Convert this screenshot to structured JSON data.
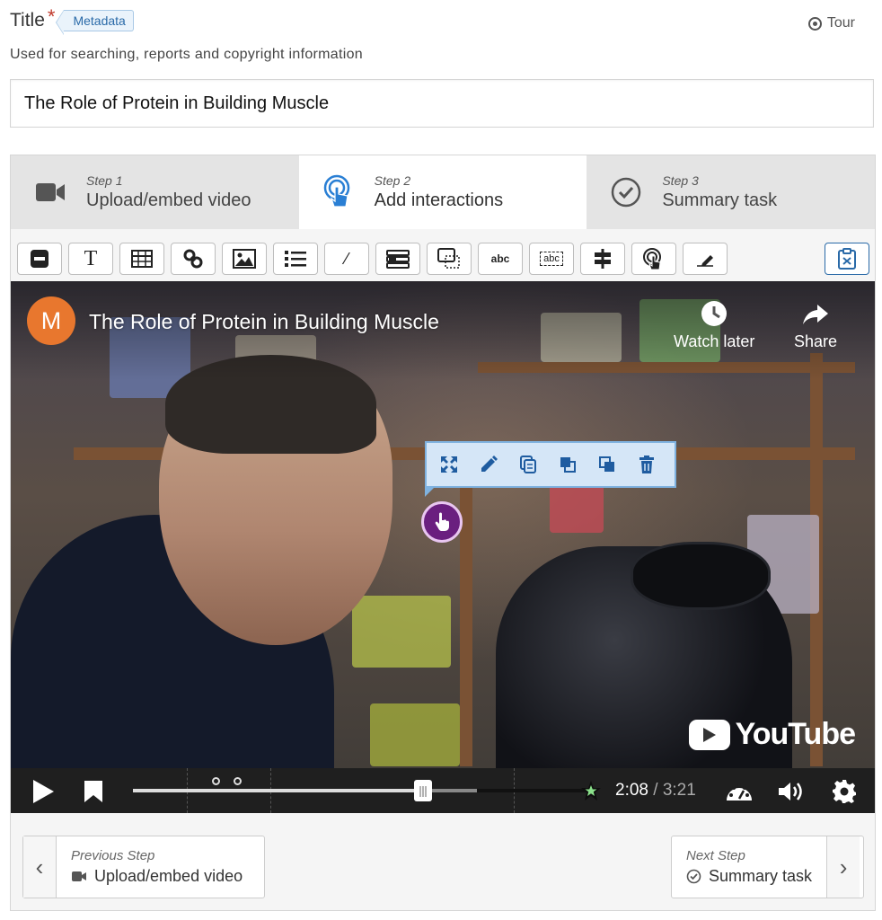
{
  "header": {
    "title_label": "Title",
    "required_mark": "*",
    "metadata_tag": "Metadata",
    "tour_label": "Tour",
    "description": "Used for searching, reports and copyright information"
  },
  "title_input": {
    "value": "The Role of Protein in Building Muscle"
  },
  "steps": [
    {
      "step": "Step 1",
      "label": "Upload/embed video",
      "icon": "video-camera-icon",
      "active": false
    },
    {
      "step": "Step 2",
      "label": "Add interactions",
      "icon": "interaction-hand-icon",
      "active": true
    },
    {
      "step": "Step 3",
      "label": "Summary task",
      "icon": "check-circle-icon",
      "active": false
    }
  ],
  "toolbar": {
    "tools": [
      "label-tool",
      "text-tool",
      "table-tool",
      "link-tool",
      "image-tool",
      "statements-tool",
      "single-choice-tool",
      "multiple-choice-tool",
      "drag-and-drop-tool",
      "fill-blanks-tool",
      "drag-text-tool",
      "crossroads-tool",
      "navigation-hotspot-tool",
      "free-text-tool"
    ],
    "text_tool_glyph": "T",
    "fraction_tool_glyph": "⁄",
    "fill_blank_glyph": "abc",
    "drag_text_glyph": "abc"
  },
  "video": {
    "channel_initial": "M",
    "title": "The Role of Protein in Building Muscle",
    "watch_later": "Watch later",
    "share": "Share",
    "brand": "YouTube",
    "current_time": "2:08",
    "separator": "/",
    "duration": "3:21",
    "progress_fraction": 0.634
  },
  "navigation": {
    "previous_small": "Previous Step",
    "previous_label": "Upload/embed video",
    "next_small": "Next Step",
    "next_label": "Summary task",
    "prev_arrow": "‹",
    "next_arrow": "›"
  }
}
